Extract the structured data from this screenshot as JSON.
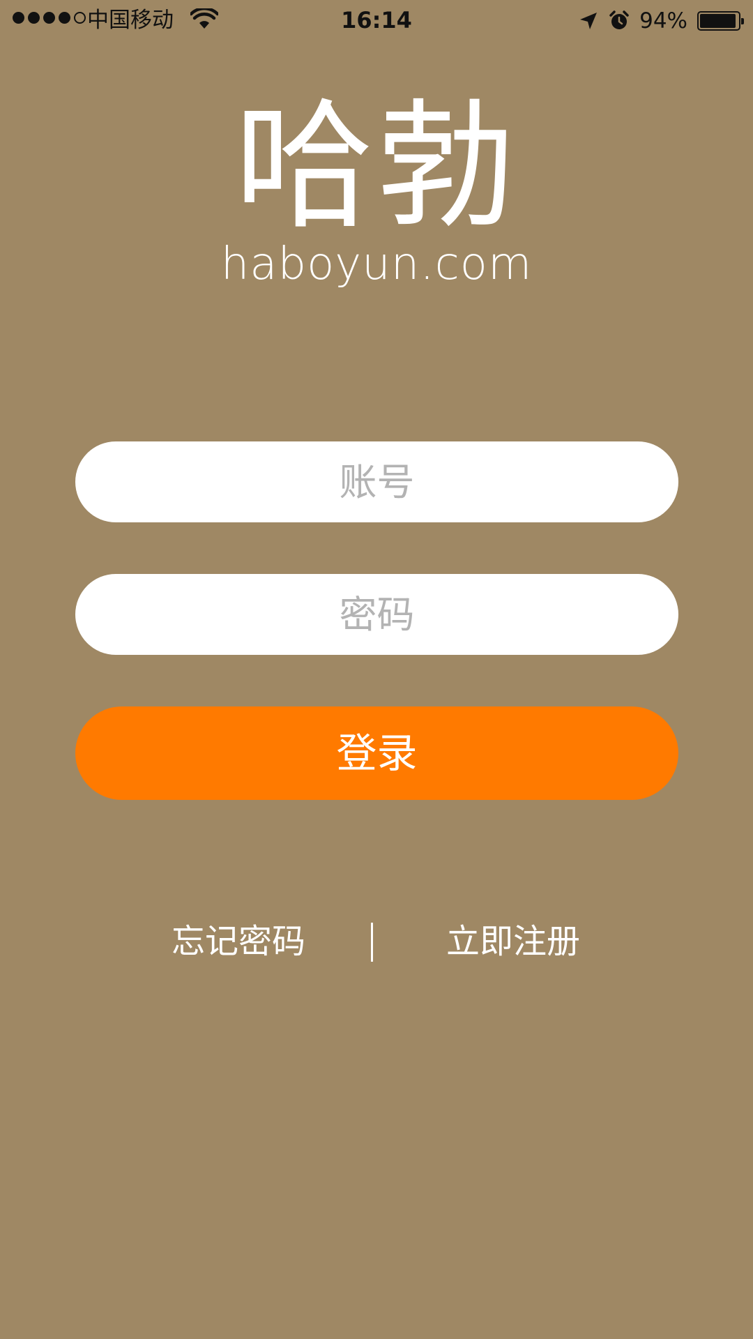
{
  "status_bar": {
    "carrier": "中国移动",
    "time": "16:14",
    "battery": "94%",
    "battery_level": 0.94,
    "signal_bars_filled": 4,
    "signal_bars_total": 5,
    "icons": [
      "signal-dots",
      "wifi-icon",
      "location-arrow-icon",
      "alarm-clock-icon",
      "battery-icon"
    ]
  },
  "logo": {
    "mark": "哈勃",
    "url": "haboyun.com"
  },
  "form": {
    "account_placeholder": "账号",
    "password_placeholder": "密码",
    "login_label": "登录"
  },
  "links": {
    "forgot_password": "忘记密码",
    "divider": "|",
    "register": "立即注册"
  },
  "colors": {
    "background": "#9f8864",
    "accent": "#ff7a00",
    "field_background": "#ffffff",
    "placeholder": "#b3b3b3"
  }
}
